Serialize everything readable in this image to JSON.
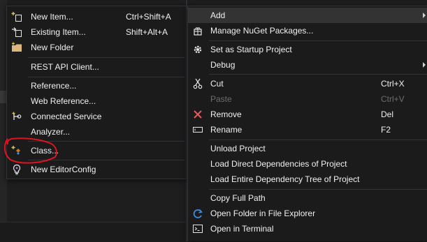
{
  "submenu": {
    "items": [
      {
        "label": "New Item...",
        "shortcut": "Ctrl+Shift+A",
        "icon": "new-item-icon"
      },
      {
        "label": "Existing Item...",
        "shortcut": "Shift+Alt+A",
        "icon": "existing-item-icon"
      },
      {
        "label": "New Folder",
        "shortcut": "",
        "icon": "folder-icon"
      },
      {
        "label": "REST API Client...",
        "shortcut": "",
        "icon": ""
      },
      {
        "label": "Reference...",
        "shortcut": "",
        "icon": ""
      },
      {
        "label": "Web Reference...",
        "shortcut": "",
        "icon": ""
      },
      {
        "label": "Connected Service",
        "shortcut": "",
        "icon": "connected-service-icon"
      },
      {
        "label": "Analyzer...",
        "shortcut": "",
        "icon": ""
      },
      {
        "label": "Class...",
        "shortcut": "",
        "icon": "add-class-icon"
      },
      {
        "label": "New EditorConfig",
        "shortcut": "",
        "icon": "editorconfig-icon"
      }
    ]
  },
  "context_menu": {
    "items": [
      {
        "label": "Add",
        "shortcut": "",
        "icon": ""
      },
      {
        "label": "Manage NuGet Packages...",
        "shortcut": "",
        "icon": "nuget-icon"
      },
      {
        "label": "Set as Startup Project",
        "shortcut": "",
        "icon": "gear-icon"
      },
      {
        "label": "Debug",
        "shortcut": "",
        "icon": ""
      },
      {
        "label": "Cut",
        "shortcut": "Ctrl+X",
        "icon": "scissors-icon"
      },
      {
        "label": "Paste",
        "shortcut": "Ctrl+V",
        "icon": ""
      },
      {
        "label": "Remove",
        "shortcut": "Del",
        "icon": "remove-x-icon"
      },
      {
        "label": "Rename",
        "shortcut": "F2",
        "icon": "rename-icon"
      },
      {
        "label": "Unload Project",
        "shortcut": "",
        "icon": ""
      },
      {
        "label": "Load Direct Dependencies of Project",
        "shortcut": "",
        "icon": ""
      },
      {
        "label": "Load Entire Dependency Tree of Project",
        "shortcut": "",
        "icon": ""
      },
      {
        "label": "Copy Full Path",
        "shortcut": "",
        "icon": ""
      },
      {
        "label": "Open Folder in File Explorer",
        "shortcut": "",
        "icon": "open-folder-icon"
      },
      {
        "label": "Open in Terminal",
        "shortcut": "",
        "icon": "terminal-icon"
      }
    ]
  },
  "colors": {
    "menu_bg": "#1b1b1c",
    "highlight": "#333334",
    "text": "#f1f1f1",
    "disabled_text": "#6d6d6d",
    "annotation_red": "#e0141e",
    "remove_red": "#e85a5a",
    "accent_blue": "#3d8ee8"
  }
}
